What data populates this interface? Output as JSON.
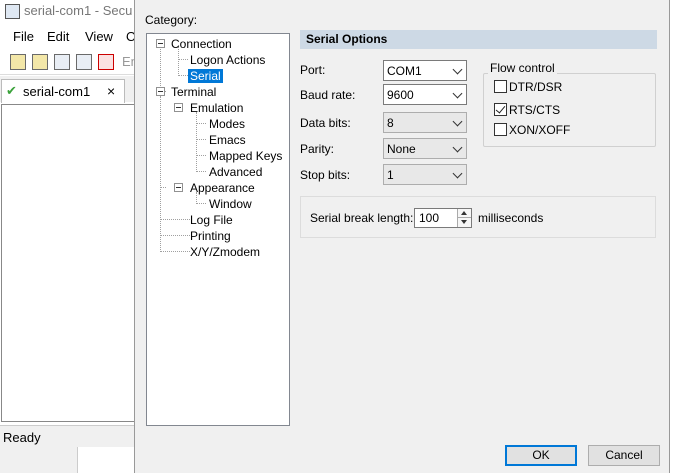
{
  "bg_app": {
    "window_title": "serial-com1 - Secu",
    "menu": [
      "File",
      "Edit",
      "View",
      "O"
    ],
    "toolbar_text": "En",
    "tab_label": "serial-com1",
    "tab_close": "×",
    "status": "Ready"
  },
  "dialog": {
    "category_label": "Category:",
    "tree": [
      {
        "label": "Connection"
      },
      {
        "label": "Logon Actions"
      },
      {
        "label": "Serial",
        "selected": true
      },
      {
        "label": "Terminal"
      },
      {
        "label": "Emulation"
      },
      {
        "label": "Modes"
      },
      {
        "label": "Emacs"
      },
      {
        "label": "Mapped Keys"
      },
      {
        "label": "Advanced"
      },
      {
        "label": "Appearance"
      },
      {
        "label": "Window"
      },
      {
        "label": "Log File"
      },
      {
        "label": "Printing"
      },
      {
        "label": "X/Y/Zmodem"
      }
    ],
    "section_title": "Serial Options",
    "fields": {
      "port": {
        "label": "Port:",
        "value": "COM1"
      },
      "baud": {
        "label": "Baud rate:",
        "value": "9600"
      },
      "data_bits": {
        "label": "Data bits:",
        "value": "8"
      },
      "parity": {
        "label": "Parity:",
        "value": "None"
      },
      "stop_bits": {
        "label": "Stop bits:",
        "value": "1"
      }
    },
    "flow_control": {
      "title": "Flow control",
      "options": [
        {
          "label": "DTR/DSR",
          "checked": false
        },
        {
          "label": "RTS/CTS",
          "checked": true
        },
        {
          "label": "XON/XOFF",
          "checked": false
        }
      ]
    },
    "break_length": {
      "label": "Serial break length:",
      "value": "100",
      "unit": "milliseconds"
    },
    "buttons": {
      "ok": "OK",
      "cancel": "Cancel"
    }
  },
  "colors": {
    "selection": "#0078d7",
    "section_header": "#cdd9e5",
    "dialog_bg": "#f0f0f0"
  }
}
